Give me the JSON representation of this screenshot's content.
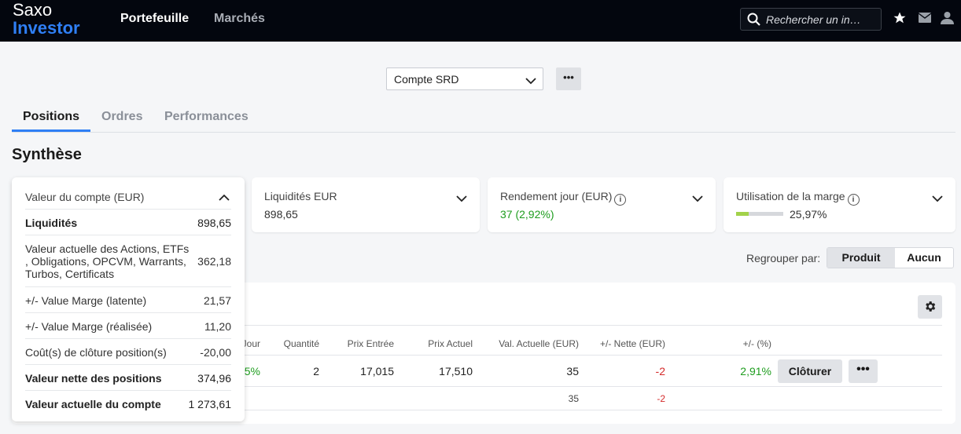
{
  "logo": {
    "line1": "Saxo",
    "line2": "Investor"
  },
  "nav": {
    "portefeuille": "Portefeuille",
    "marches": "Marchés"
  },
  "search": {
    "placeholder": "Rechercher un in…"
  },
  "account": {
    "selected": "Compte SRD",
    "more": "•••"
  },
  "tabs": {
    "positions": "Positions",
    "ordres": "Ordres",
    "performances": "Performances"
  },
  "section_title": "Synthèse",
  "cards": {
    "valeur_compte": {
      "title": "Valeur du compte (EUR)"
    },
    "liquidites": {
      "title": "Liquidités EUR",
      "value": "898,65"
    },
    "rendement": {
      "title": "Rendement jour (EUR)",
      "value": "37 (2,92%)"
    },
    "marge": {
      "title": "Utilisation de la marge",
      "value": "25,97%",
      "fill_fraction": 0.2597,
      "fill_color": "#a2d24a"
    }
  },
  "account_breakdown": [
    {
      "label": "Liquidités",
      "value": "898,65"
    },
    {
      "label": "Valeur actuelle des Actions, ETFs , Obligations, OPCVM, Warrants, Turbos, Certificats",
      "value": "362,18"
    },
    {
      "label": "+/- Value Marge (latente)",
      "value": "21,57"
    },
    {
      "label": "+/- Value Marge (réalisée)",
      "value": "11,20"
    },
    {
      "label": "Coût(s) de clôture position(s)",
      "value": "-20,00"
    },
    {
      "label": "Valeur nette des positions",
      "value": "374,96"
    },
    {
      "label": "Valeur actuelle du compte",
      "value": "1 273,61"
    }
  ],
  "group_by": {
    "label": "Regrouper par:",
    "options": [
      "Produit",
      "Aucun"
    ],
    "selected": "Produit"
  },
  "positions_table": {
    "headers": {
      "jour": "Jour",
      "quantite": "Quantité",
      "prix_entree": "Prix Entrée",
      "prix_actuel": "Prix Actuel",
      "val_actuelle": "Val. Actuelle (EUR)",
      "nette": "+/- Nette (EUR)",
      "pct": "+/- (%)"
    },
    "row": {
      "jour": "5%",
      "quantite": "2",
      "prix_entree": "17,015",
      "prix_actuel": "17,510",
      "val_actuelle": "35",
      "nette": "-2",
      "pct": "2,91%"
    },
    "totals": {
      "val_actuelle": "35",
      "nette": "-2"
    },
    "close_label": "Clôturer",
    "more_label": "•••"
  },
  "colors": {
    "brand_blue": "#2f7ff5",
    "positive": "#1f9d1f",
    "negative": "#d42a2a",
    "topbar": "#03060e"
  }
}
